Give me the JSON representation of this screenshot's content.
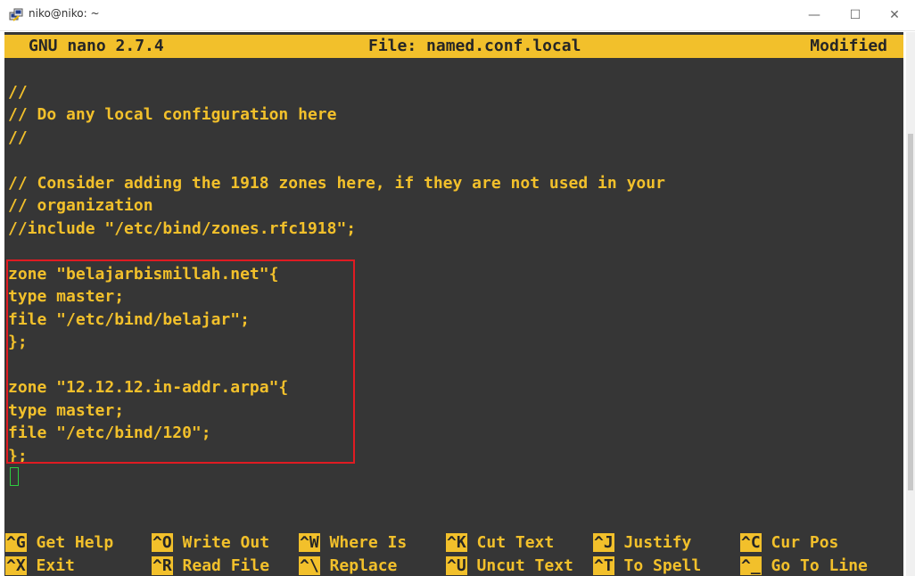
{
  "window": {
    "title": "niko@niko: ~",
    "icon": "putty-icon",
    "controls": {
      "minimize": "—",
      "maximize": "☐",
      "close": "✕"
    }
  },
  "nano": {
    "version_label": "GNU nano 2.7.4",
    "file_label": "File: named.conf.local",
    "status": "Modified"
  },
  "editor": {
    "lines": [
      "//",
      "// Do any local configuration here",
      "//",
      "",
      "// Consider adding the 1918 zones here, if they are not used in your",
      "// organization",
      "//include \"/etc/bind/zones.rfc1918\";",
      "",
      "zone \"belajarbismillah.net\"{",
      "type master;",
      "file \"/etc/bind/belajar\";",
      "};",
      "",
      "zone \"12.12.12.in-addr.arpa\"{",
      "type master;",
      "file \"/etc/bind/120\";",
      "};"
    ]
  },
  "shortcuts": {
    "row1": [
      {
        "key": "^G",
        "label": " Get Help"
      },
      {
        "key": "^O",
        "label": " Write Out"
      },
      {
        "key": "^W",
        "label": " Where Is"
      },
      {
        "key": "^K",
        "label": " Cut Text"
      },
      {
        "key": "^J",
        "label": " Justify"
      },
      {
        "key": "^C",
        "label": " Cur Pos"
      }
    ],
    "row2": [
      {
        "key": "^X",
        "label": " Exit"
      },
      {
        "key": "^R",
        "label": " Read File"
      },
      {
        "key": "^\\",
        "label": " Replace"
      },
      {
        "key": "^U",
        "label": " Uncut Text"
      },
      {
        "key": "^T",
        "label": " To Spell"
      },
      {
        "key": "^_",
        "label": " Go To Line"
      }
    ]
  },
  "colors": {
    "terminal_bg": "#363636",
    "text": "#f2c02b",
    "highlight_border": "#e01b22",
    "cursor": "#2ecc40"
  }
}
